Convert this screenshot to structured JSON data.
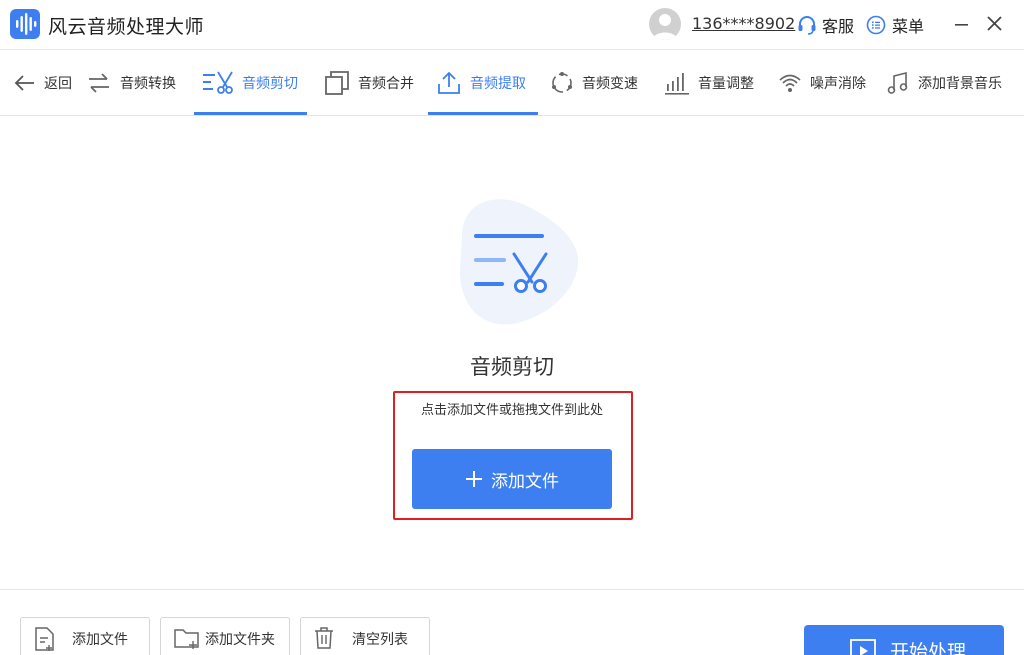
{
  "app": {
    "title": "风云音频处理大师",
    "accent_color": "#3d7ff0",
    "highlight_color": "#e02020"
  },
  "header": {
    "user_phone": "136****8902",
    "support_label": "客服",
    "menu_label": "菜单",
    "icons": [
      "app-logo-icon",
      "avatar-icon",
      "headset-icon",
      "menu-list-icon",
      "minimize-icon",
      "close-icon"
    ]
  },
  "toolbar": {
    "back_label": "返回",
    "tabs": [
      {
        "label": "音频转换",
        "icon": "convert-icon",
        "active": false
      },
      {
        "label": "音频剪切",
        "icon": "scissors-icon",
        "active": true
      },
      {
        "label": "音频合并",
        "icon": "merge-icon",
        "active": false
      },
      {
        "label": "音频提取",
        "icon": "upload-icon",
        "active": true
      },
      {
        "label": "音频变速",
        "icon": "speed-icon",
        "active": false
      },
      {
        "label": "音量调整",
        "icon": "volume-bars-icon",
        "active": false
      },
      {
        "label": "噪声消除",
        "icon": "wifi-noise-icon",
        "active": false
      },
      {
        "label": "添加背景音乐",
        "icon": "music-note-icon",
        "active": false
      }
    ]
  },
  "main": {
    "section_title": "音频剪切",
    "hint": "点击添加文件或拖拽文件到此处",
    "add_file_label": "添加文件"
  },
  "bottom": {
    "add_file_label": "添加文件",
    "add_folder_label": "添加文件夹",
    "clear_list_label": "清空列表",
    "start_label": "开始处理"
  }
}
